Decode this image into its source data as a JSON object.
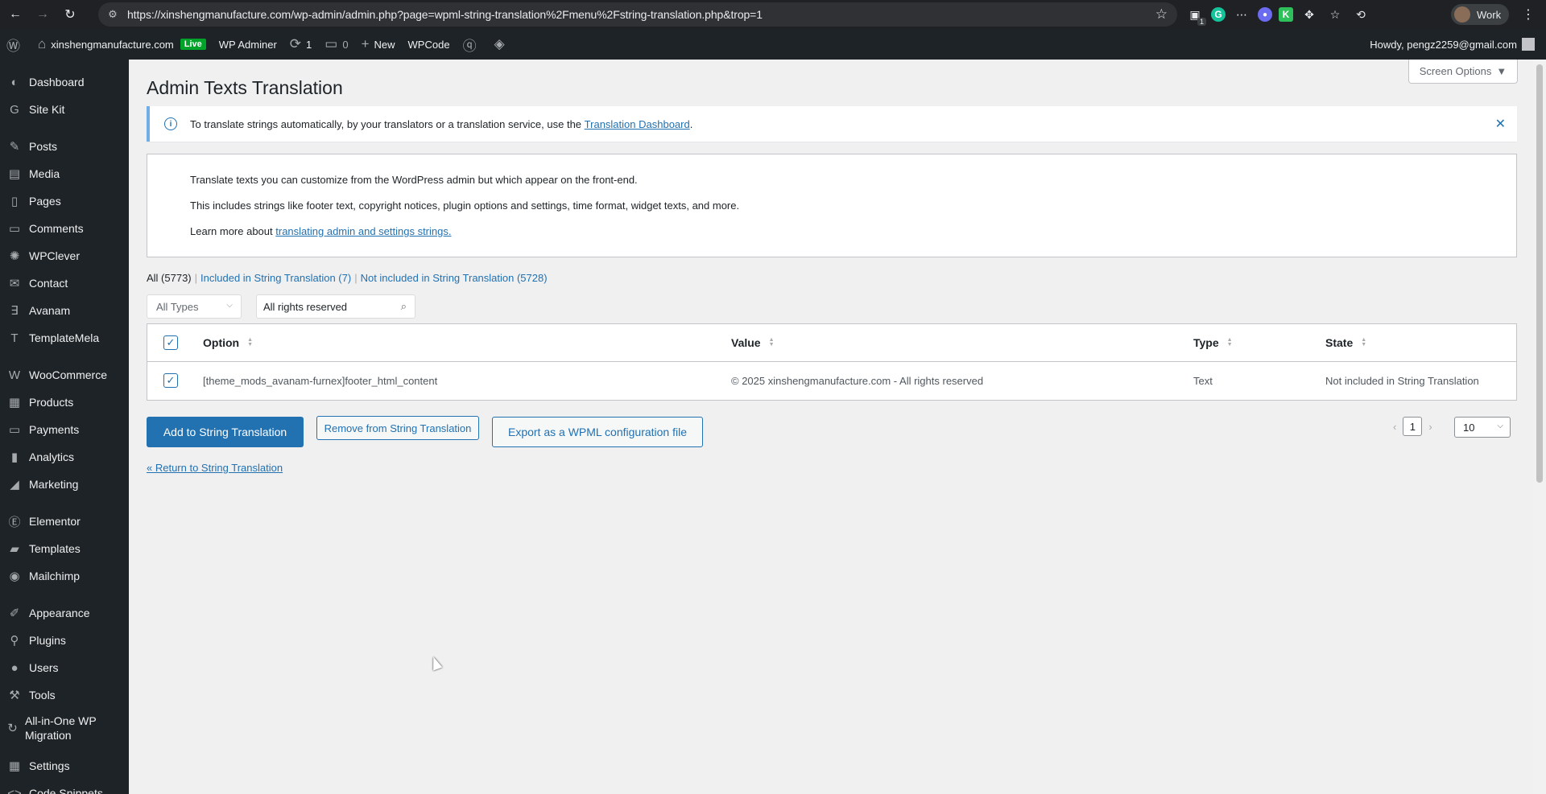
{
  "browser": {
    "url": "https://xinshengmanufacture.com/wp-admin/admin.php?page=wpml-string-translation%2Fmenu%2Fstring-translation.php&trop=1",
    "profile_label": "Work",
    "ext_badge": "1"
  },
  "adminbar": {
    "site_name": "xinshengmanufacture.com",
    "live": "Live",
    "wp_adminer": "WP Adminer",
    "updates_count": "1",
    "comments_count": "0",
    "new_label": "New",
    "wpcode": "WPCode",
    "howdy": "Howdy, pengz2259@gmail.com"
  },
  "sidebar": {
    "items": [
      {
        "label": "Dashboard",
        "icon": "dashboard-icon"
      },
      {
        "label": "Site Kit",
        "icon": "sitekit-icon"
      },
      {
        "label": "Posts",
        "icon": "pin-icon"
      },
      {
        "label": "Media",
        "icon": "media-icon"
      },
      {
        "label": "Pages",
        "icon": "pages-icon"
      },
      {
        "label": "Comments",
        "icon": "comments-icon"
      },
      {
        "label": "WPClever",
        "icon": "wpclever-icon"
      },
      {
        "label": "Contact",
        "icon": "mail-icon"
      },
      {
        "label": "Avanam",
        "icon": "avanam-icon"
      },
      {
        "label": "TemplateMela",
        "icon": "templatemela-icon"
      },
      {
        "label": "WooCommerce",
        "icon": "woocommerce-icon"
      },
      {
        "label": "Products",
        "icon": "products-icon"
      },
      {
        "label": "Payments",
        "icon": "payments-icon"
      },
      {
        "label": "Analytics",
        "icon": "analytics-icon"
      },
      {
        "label": "Marketing",
        "icon": "marketing-icon"
      },
      {
        "label": "Elementor",
        "icon": "elementor-icon"
      },
      {
        "label": "Templates",
        "icon": "folder-icon"
      },
      {
        "label": "Mailchimp",
        "icon": "mailchimp-icon"
      },
      {
        "label": "Appearance",
        "icon": "brush-icon"
      },
      {
        "label": "Plugins",
        "icon": "plugin-icon"
      },
      {
        "label": "Users",
        "icon": "user-icon"
      },
      {
        "label": "Tools",
        "icon": "wrench-icon"
      },
      {
        "label": "All-in-One WP Migration",
        "icon": "migration-icon"
      },
      {
        "label": "Settings",
        "icon": "settings-icon"
      },
      {
        "label": "Code Snippets",
        "icon": "code-icon"
      }
    ]
  },
  "page": {
    "screen_options": "Screen Options",
    "title": "Admin Texts Translation",
    "notice_text": "To translate strings automatically, by your translators or a translation service, use the",
    "notice_link": "Translation Dashboard",
    "notice_end": ".",
    "intro_line1": "Translate texts you can customize from the WordPress admin but which appear on the front-end.",
    "intro_line2": "This includes strings like footer text, copyright notices, plugin options and settings, time format, widget texts, and more.",
    "intro_line3_prefix": "Learn more about",
    "intro_line3_link": "translating admin and settings strings."
  },
  "filters": {
    "all": "All (5773)",
    "included": "Included in String Translation (7)",
    "not_included": "Not included in String Translation (5728)",
    "type_select": "All Types",
    "search_value": "All rights reserved"
  },
  "table": {
    "headers": {
      "option": "Option",
      "value": "Value",
      "type": "Type",
      "state": "State"
    },
    "rows": [
      {
        "option": "[theme_mods_avanam-furnex]footer_html_content",
        "value": "© 2025 xinshengmanufacture.com - All rights reserved",
        "type": "Text",
        "state": "Not included in String Translation"
      }
    ]
  },
  "actions": {
    "add": "Add to String Translation",
    "remove": "Remove from String Translation",
    "export": "Export as a WPML configuration file",
    "return": "« Return to String Translation",
    "page_number": "1",
    "per_page": "10"
  },
  "colors": {
    "primary": "#2271b1",
    "adminbar": "#1d2327",
    "live": "#00a32a"
  }
}
